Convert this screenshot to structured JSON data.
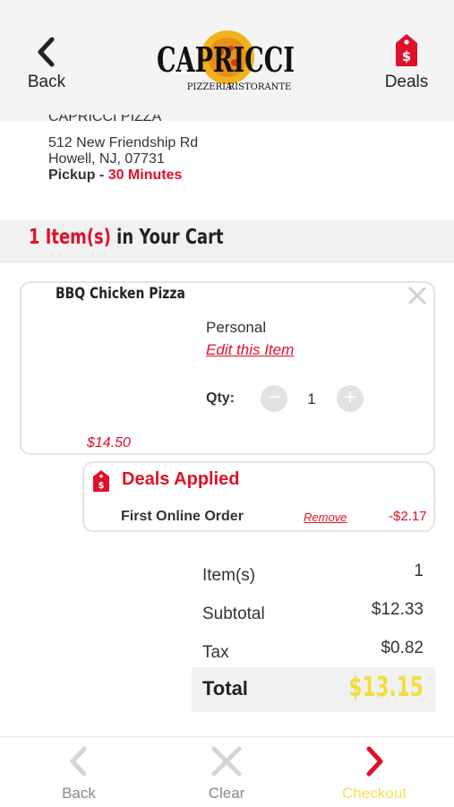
{
  "header": {
    "back_label": "Back",
    "deals_label": "Deals",
    "logo": {
      "name": "CAPRICCI",
      "subtitle_left": "PIZZERIA",
      "subtitle_right": "RISTORANTE"
    }
  },
  "store": {
    "name_partial": "CAPRICCI PIZZA",
    "address_line1": "512 New Friendship Rd",
    "address_line2": "Howell, NJ, 07731",
    "pickup_label": "Pickup - ",
    "pickup_time": "30 Minutes"
  },
  "cart": {
    "title": "1 Item(s) in Your Cart",
    "item": {
      "name": "BBQ Chicken Pizza",
      "size": "Personal",
      "edit_label": "Edit this Item",
      "qty_label": "Qty:",
      "qty": "1",
      "price": "$14.50"
    },
    "deals": {
      "title": "Deals Applied",
      "deal_name": "First Online Order",
      "remove_label": "Remove",
      "amount": "-$2.17"
    }
  },
  "summary": {
    "items_label": "Item(s)",
    "items_value": "1",
    "subtotal_label": "Subtotal",
    "subtotal_value": "$12.33",
    "tax_label": "Tax",
    "tax_value": "$0.82",
    "total_label": "Total",
    "total_value": "$13.15"
  },
  "bottom_bar": {
    "back_label": "Back",
    "clear_label": "Clear",
    "checkout_label": "Checkout"
  },
  "colors": {
    "accent_red": "#e0102a",
    "total_yellow": "#f0de3a",
    "checkout_yellow": "#f3e35a"
  }
}
